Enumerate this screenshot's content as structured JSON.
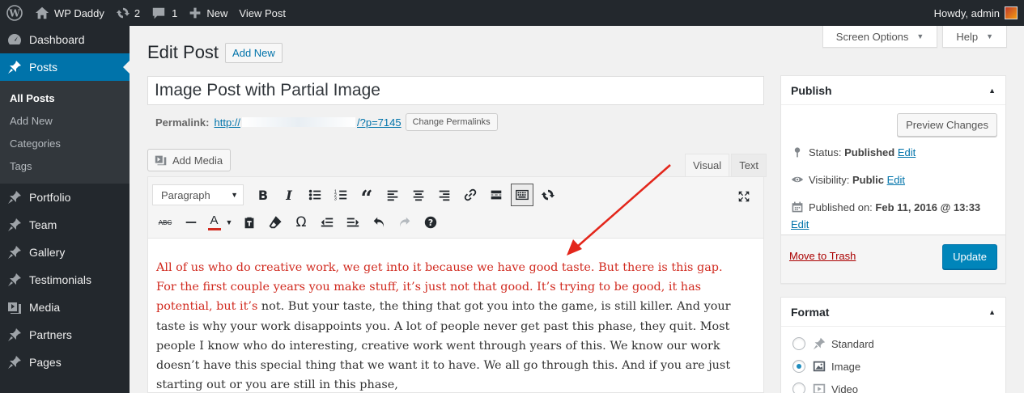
{
  "admin_bar": {
    "site_name": "WP Daddy",
    "updates_count": "2",
    "comments_count": "1",
    "new_label": "New",
    "view_post_label": "View Post",
    "howdy": "Howdy, admin"
  },
  "sidebar": {
    "items": [
      {
        "label": "Dashboard",
        "icon": "dashboard-icon"
      },
      {
        "label": "Posts",
        "icon": "pin-icon"
      },
      {
        "label": "Portfolio",
        "icon": "pin-icon"
      },
      {
        "label": "Team",
        "icon": "pin-icon"
      },
      {
        "label": "Gallery",
        "icon": "pin-icon"
      },
      {
        "label": "Testimonials",
        "icon": "pin-icon"
      },
      {
        "label": "Media",
        "icon": "media-icon"
      },
      {
        "label": "Partners",
        "icon": "pin-icon"
      },
      {
        "label": "Pages",
        "icon": "pin-icon"
      }
    ],
    "submenu": [
      "All Posts",
      "Add New",
      "Categories",
      "Tags"
    ]
  },
  "screen_options": {
    "screen_options_label": "Screen Options",
    "help_label": "Help"
  },
  "page": {
    "title": "Edit Post",
    "add_new_label": "Add New",
    "post_title": "Image Post with Partial Image",
    "permalink_label": "Permalink:",
    "permalink_start": "http://",
    "permalink_end": "/?p=7145",
    "change_permalinks_label": "Change Permalinks"
  },
  "editor": {
    "add_media_label": "Add Media",
    "tab_visual": "Visual",
    "tab_text": "Text",
    "format_select": "Paragraph",
    "content_red": "All of us who do creative work, we get into it because we have good taste. But there is this gap. For the first couple years you make stuff, it’s just not that good. It’s trying to be good, it has potential, but it’s",
    "content_rest": " not. But your taste, the thing that got you into the game, is still killer. And your taste is why your work disappoints you. A lot of people never get past this phase, they quit. Most people I know who do interesting, creative work went through years of this. We know our work doesn’t have this special thing that we want it to have. We all go through this. And if you are just starting out or you are still in this phase,",
    "highlight_color": "#d12a1f"
  },
  "publish": {
    "title": "Publish",
    "preview_label": "Preview Changes",
    "status_label": "Status:",
    "status_value": "Published",
    "visibility_label": "Visibility:",
    "visibility_value": "Public",
    "published_label": "Published on:",
    "published_value": "Feb 11, 2016 @ 13:33",
    "edit_label": "Edit",
    "trash_label": "Move to Trash",
    "update_label": "Update"
  },
  "format": {
    "title": "Format",
    "options": [
      {
        "label": "Standard",
        "checked": false
      },
      {
        "label": "Image",
        "checked": true
      },
      {
        "label": "Video",
        "checked": false
      }
    ]
  },
  "colors": {
    "accent": "#0073aa",
    "admin_bar": "#23282d",
    "update_button": "#0085ba",
    "arrow": "#e3261b"
  }
}
